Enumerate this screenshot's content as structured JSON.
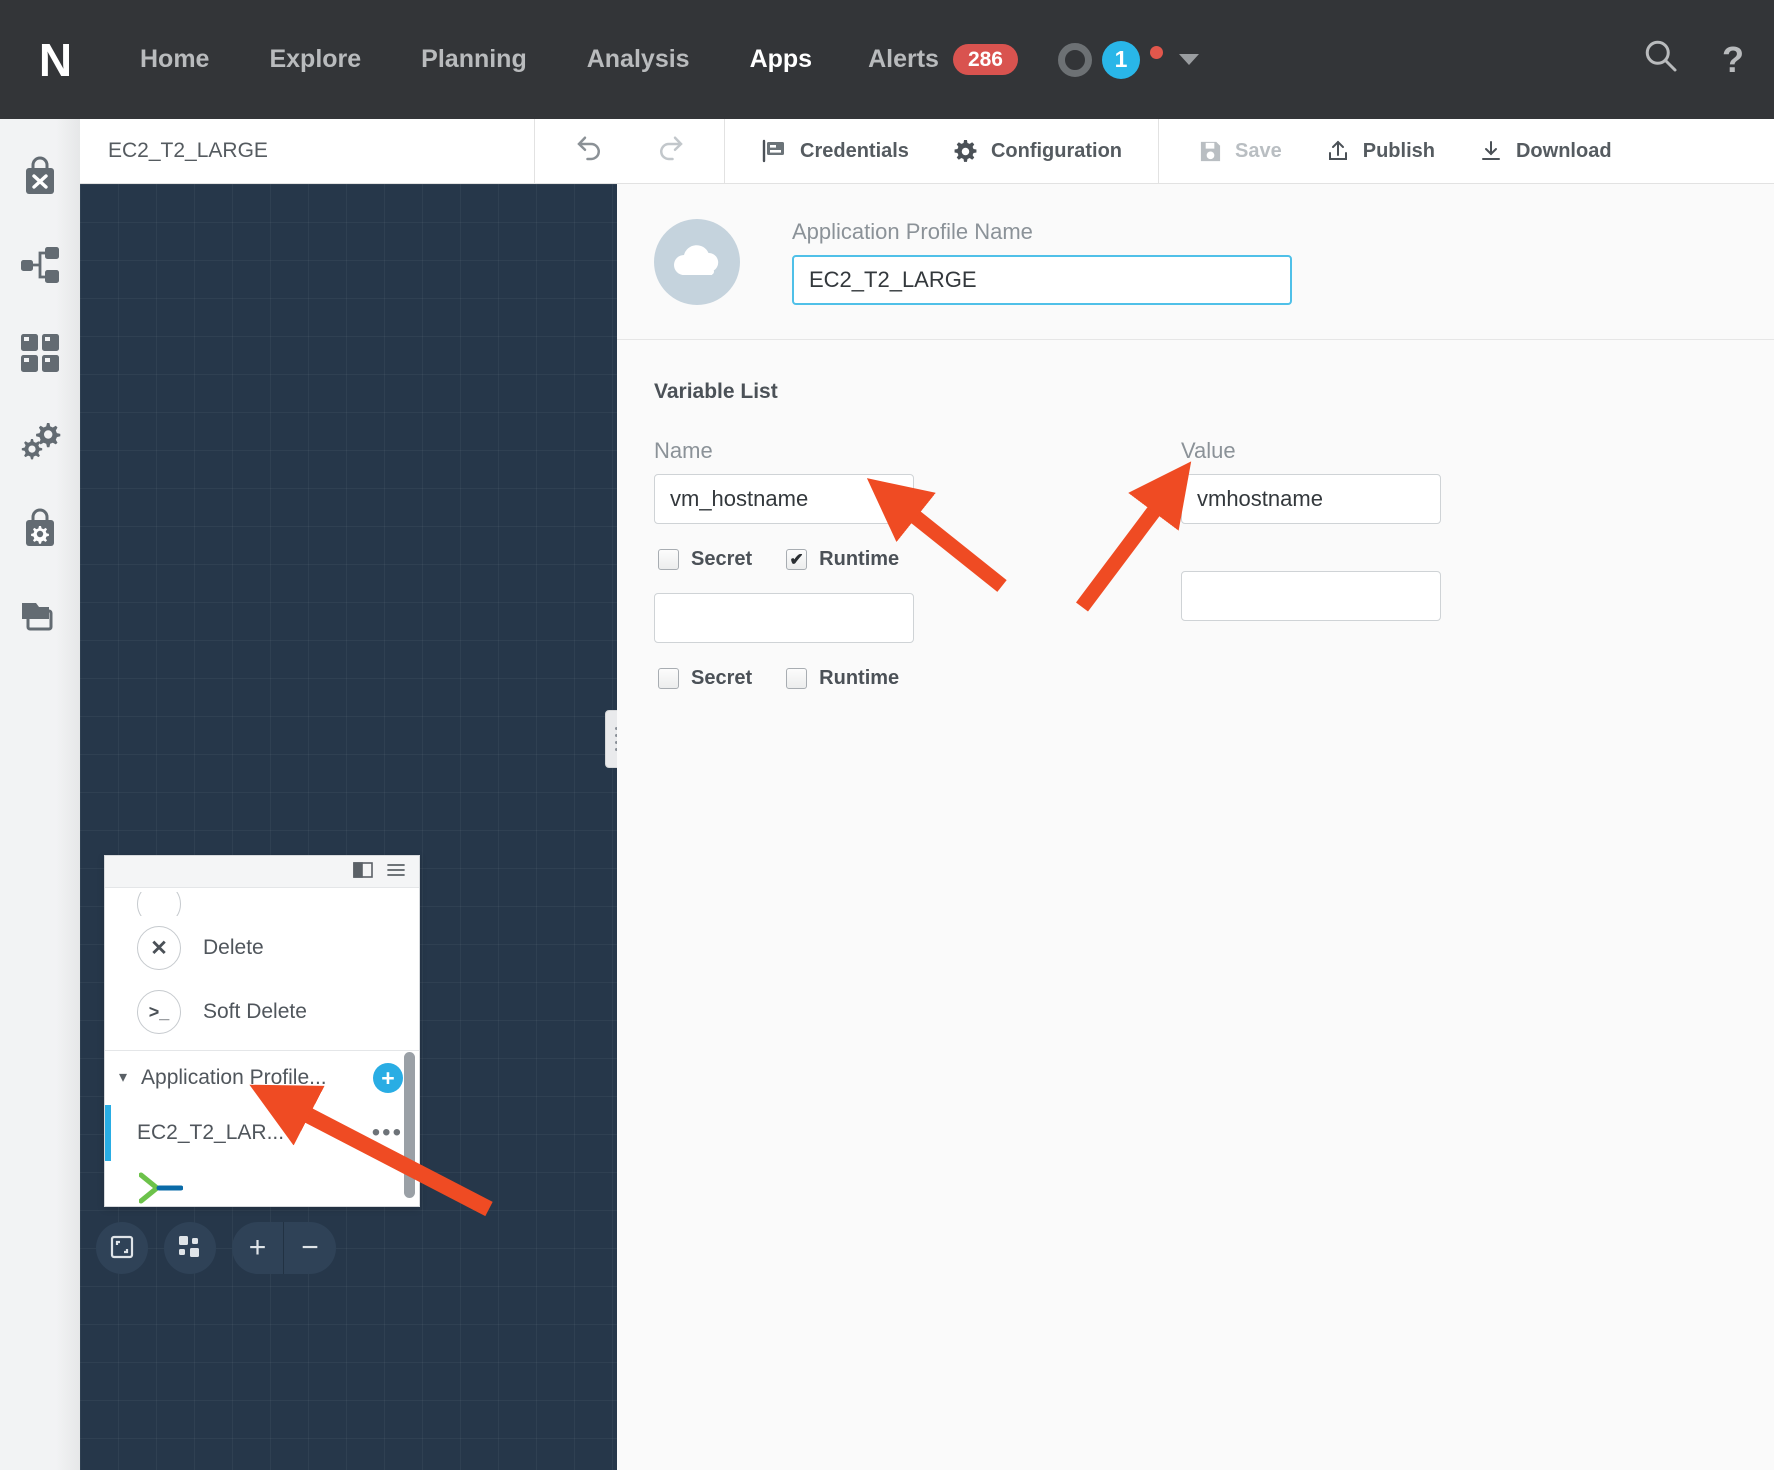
{
  "topnav": {
    "logo": "N",
    "items": [
      {
        "label": "Home",
        "active": false
      },
      {
        "label": "Explore",
        "active": false
      },
      {
        "label": "Planning",
        "active": false
      },
      {
        "label": "Analysis",
        "active": false
      },
      {
        "label": "Apps",
        "active": true
      }
    ],
    "alerts": {
      "label": "Alerts",
      "count": "286"
    },
    "status": {
      "task_count": "1"
    },
    "search_icon": "search-icon",
    "help_icon": "help-icon",
    "accent_blue": "#29b6e8",
    "badge_red": "#d9534f",
    "bar_bg": "#333538"
  },
  "toolbar": {
    "title": "EC2_T2_LARGE",
    "undo_label": "Undo",
    "redo_label": "Redo",
    "credentials_label": "Credentials",
    "configuration_label": "Configuration",
    "save_label": "Save",
    "publish_label": "Publish",
    "download_label": "Download"
  },
  "sidebar": {
    "items": [
      {
        "name": "marketplace-x-icon",
        "label": "Marketplace"
      },
      {
        "name": "blueprint-icon",
        "label": "Blueprints"
      },
      {
        "name": "apps-grid-icon",
        "label": "Applications"
      },
      {
        "name": "runbooks-gears-icon",
        "label": "Runbooks"
      },
      {
        "name": "library-gear-icon",
        "label": "Library"
      },
      {
        "name": "copy-layers-icon",
        "label": "Projects"
      }
    ]
  },
  "profile": {
    "avatar_icon": "cloud-icon",
    "name_label": "Application Profile Name",
    "name_value": "EC2_T2_LARGE",
    "name_placeholder": "Application Profile Name"
  },
  "variables": {
    "section_title": "Variable List",
    "name_header": "Name",
    "value_header": "Value",
    "secret_label": "Secret",
    "runtime_label": "Runtime",
    "rows": [
      {
        "name": "vm_hostname",
        "value": "vmhostname",
        "name_placeholder": "",
        "value_placeholder": "",
        "secret": false,
        "runtime": true
      },
      {
        "name": "",
        "value": "",
        "name_placeholder": "",
        "value_placeholder": "",
        "secret": false,
        "runtime": false
      }
    ]
  },
  "palette": {
    "panel_icon": "panel-toggle-icon",
    "menu_icon": "hamburger-menu-icon",
    "tasks": [
      {
        "icon": "delete-circle-icon",
        "glyph": "✕",
        "label": "Delete"
      },
      {
        "icon": "terminal-circle-icon",
        "glyph": ">_",
        "label": "Soft Delete"
      }
    ],
    "group": {
      "label": "Application Profile...",
      "expanded": true,
      "add_label": "+"
    },
    "child": {
      "label": "EC2_T2_LAR...",
      "menu_label": "•••"
    },
    "logo_icon": "x-brand-icon"
  },
  "bottom_controls": {
    "fit_screen_label": "Fit to screen",
    "layout_label": "Auto layout",
    "zoom_in_label": "+",
    "zoom_out_label": "−"
  },
  "annotations": {
    "arrow_color": "#ef4b23",
    "arrows": [
      {
        "name": "arrow-to-name-field",
        "target": "variable name input"
      },
      {
        "name": "arrow-to-value-field",
        "target": "variable value input"
      },
      {
        "name": "arrow-to-application-profile",
        "target": "Application Profile group"
      }
    ]
  }
}
